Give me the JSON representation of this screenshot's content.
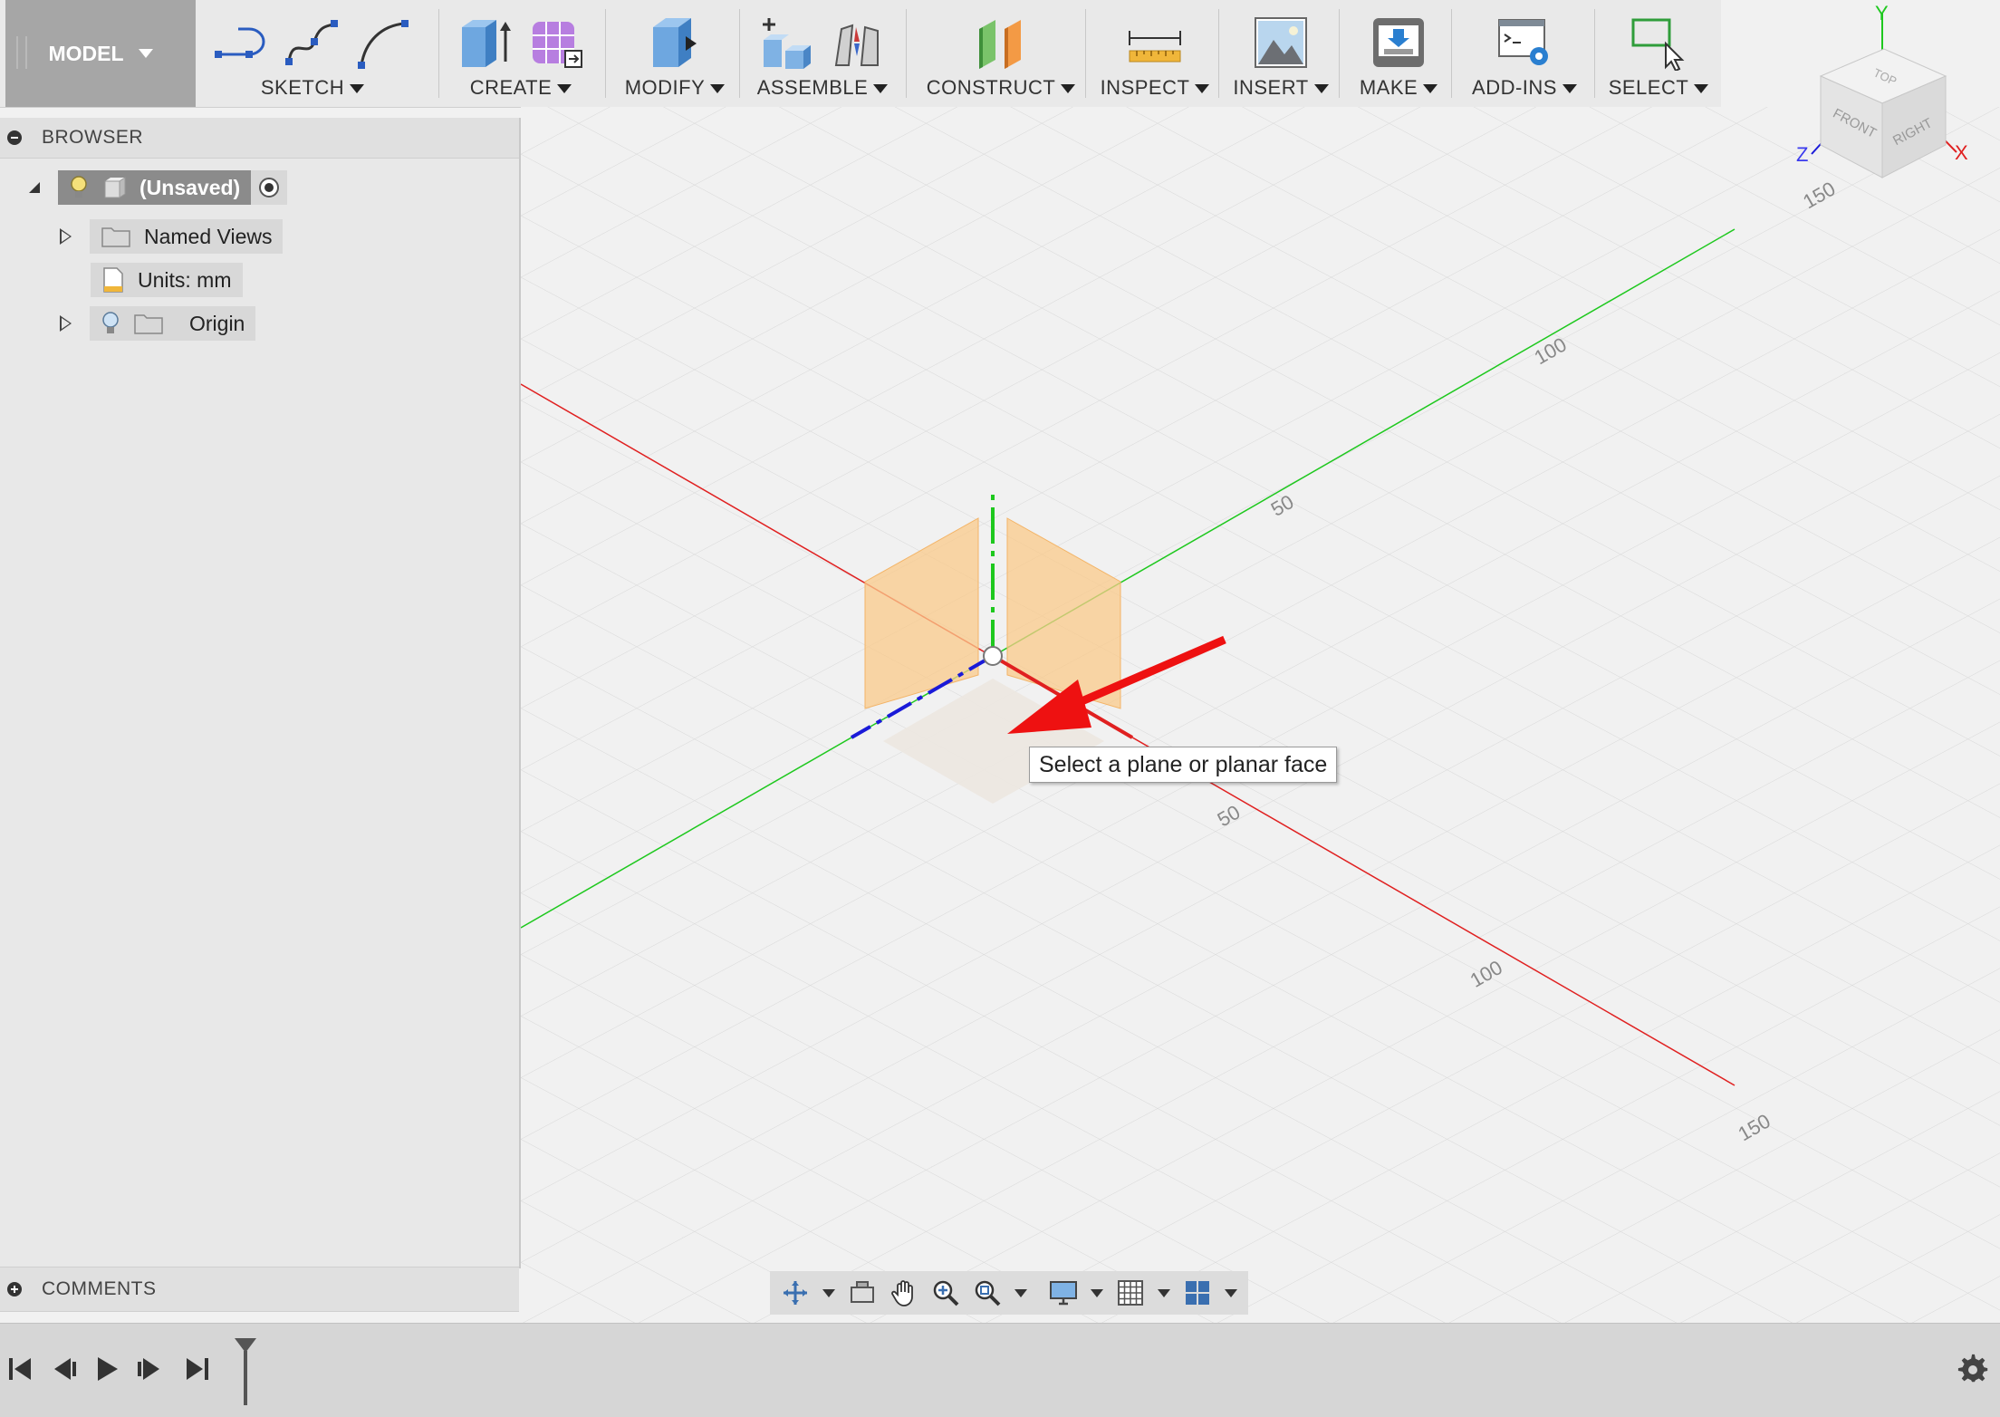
{
  "toolbar": {
    "workspace": "MODEL",
    "groups": {
      "sketch": "SKETCH",
      "create": "CREATE",
      "modify": "MODIFY",
      "assemble": "ASSEMBLE",
      "construct": "CONSTRUCT",
      "inspect": "INSPECT",
      "insert": "INSERT",
      "make": "MAKE",
      "addins": "ADD-INS",
      "select": "SELECT"
    }
  },
  "browser": {
    "title": "BROWSER",
    "root": "(Unsaved)",
    "items": [
      {
        "label": "Named Views"
      },
      {
        "label": "Units: mm"
      },
      {
        "label": "Origin"
      }
    ]
  },
  "comments": {
    "title": "COMMENTS"
  },
  "viewport": {
    "tooltip": "Select a plane or planar face",
    "green_ticks": [
      "50",
      "100"
    ],
    "red_ticks": [
      "50",
      "100",
      "150"
    ],
    "corner_tick": "150"
  },
  "viewcube": {
    "top": "TOP",
    "front": "FRONT",
    "right": "RIGHT",
    "axis_x": "X",
    "axis_y": "Y",
    "axis_z": "Z"
  },
  "colors": {
    "x_axis": "#e02020",
    "y_axis": "#1ec81e",
    "z_axis": "#1a1ad8",
    "plane": "#f9c98a",
    "arrow": "#ee1111"
  }
}
